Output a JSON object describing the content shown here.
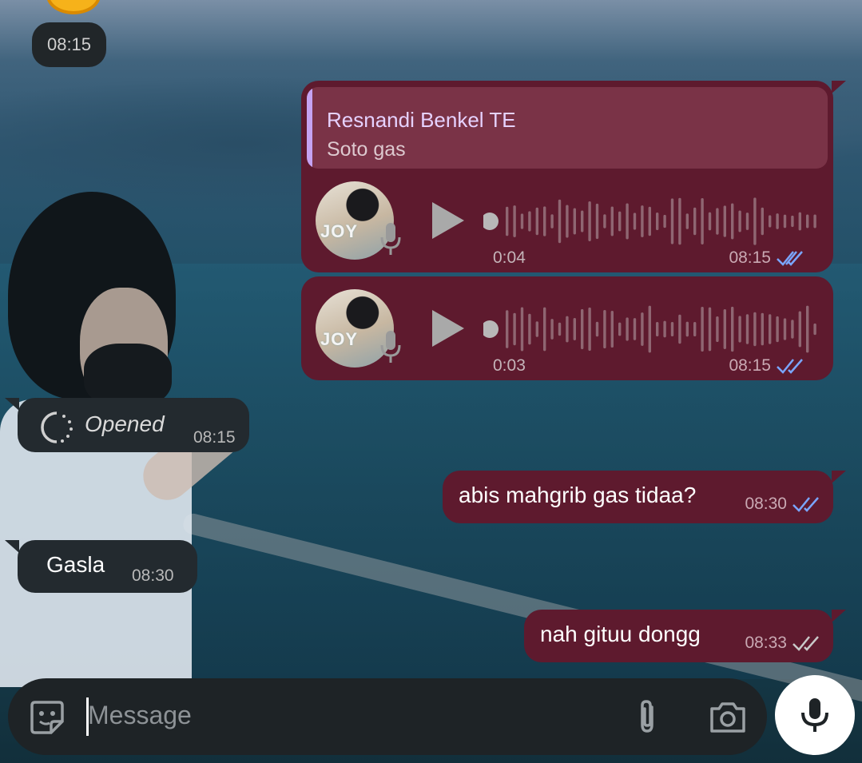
{
  "chat": {
    "date_time_pill": "08:15",
    "group1": {
      "reply_name": "Resnandi Benkel TE",
      "reply_text": "Soto gas",
      "voice_duration": "0:04",
      "voice_time": "08:15"
    },
    "group2": {
      "voice_duration": "0:03",
      "voice_time": "08:15"
    },
    "opened": {
      "label": "Opened",
      "time": "08:15"
    },
    "messages": [
      {
        "text": "abis mahgrib gas tidaa?",
        "time": "08:30",
        "status": "read"
      },
      {
        "text": "Gasla",
        "time": "08:30",
        "incoming": true
      },
      {
        "text": "nah gituu dongg",
        "time": "08:33",
        "status": "delivered"
      }
    ],
    "avatar_text": "JOY"
  },
  "composer": {
    "placeholder": "Message"
  },
  "colors": {
    "outgoing_bubble": "#5e1a2e",
    "incoming_bubble": "#232a2f",
    "reply_bar": "#c5a3f2",
    "read_ticks": "#7aa6ff"
  }
}
